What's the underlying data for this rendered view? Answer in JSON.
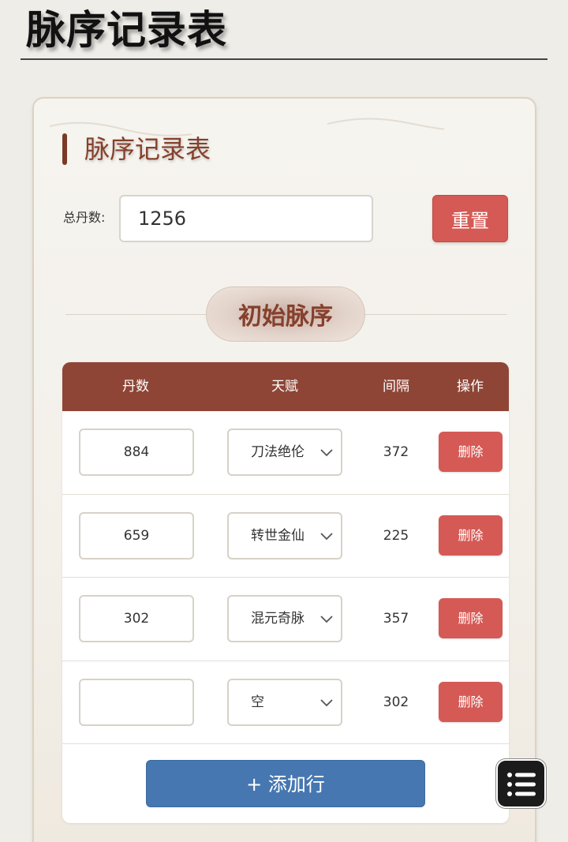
{
  "page": {
    "title": "脉序记录表"
  },
  "card": {
    "section_title": "脉序记录表",
    "total": {
      "label": "总丹数:",
      "value": "1256"
    },
    "reset_label": "重置",
    "initial_label": "初始脉序"
  },
  "table": {
    "headers": [
      "丹数",
      "天赋",
      "间隔",
      "操作"
    ],
    "rows": [
      {
        "dan": "884",
        "talent": "刀法绝伦",
        "interval": "372",
        "action": "删除"
      },
      {
        "dan": "659",
        "talent": "转世金仙",
        "interval": "225",
        "action": "删除"
      },
      {
        "dan": "302",
        "talent": "混元奇脉",
        "interval": "357",
        "action": "删除"
      },
      {
        "dan": "",
        "talent": "空",
        "interval": "302",
        "action": "删除"
      }
    ],
    "add_label": "+ 添加行"
  },
  "icons": {
    "select_chevron": "chevron-down-icon",
    "fab": "list-icon"
  },
  "colors": {
    "accent_red": "#d55a55",
    "header_brown": "#8e4535",
    "add_blue": "#4677b1",
    "title_brown": "#86402c"
  }
}
